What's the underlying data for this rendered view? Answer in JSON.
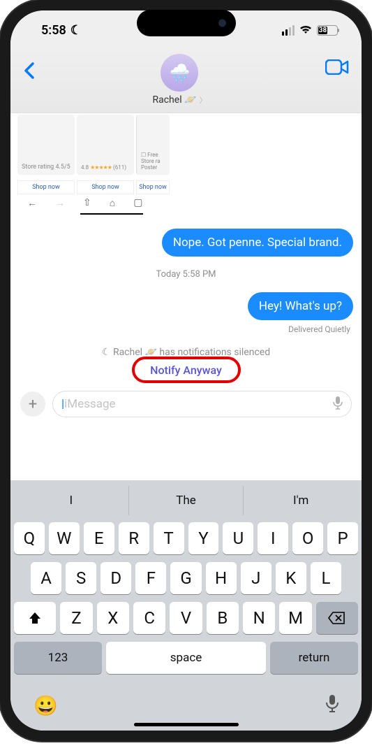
{
  "status": {
    "time": "5:58",
    "focus_icon": "☾",
    "battery_pct": "38"
  },
  "header": {
    "contact_name": "Rachel 🪐",
    "avatar_emoji": "🌧️"
  },
  "preview": {
    "card1_rating": "Store rating 4.5/5",
    "card2_score": "4.8",
    "card2_reviews": "(611)",
    "card3_line1": "Free",
    "card3_line2": "Store ra",
    "card3_line3": "Poster",
    "shop_label": "Shop now"
  },
  "messages": {
    "m1": "Nope. Got penne. Special brand.",
    "timestamp": "Today 5:58 PM",
    "m2": "Hey! What's up?",
    "delivered": "Delivered Quietly",
    "silenced_text": "Rachel 🪐 has notifications silenced",
    "notify_anyway": "Notify Anyway"
  },
  "input": {
    "placeholder": "iMessage"
  },
  "keyboard": {
    "predictions": [
      "I",
      "The",
      "I'm"
    ],
    "row1": [
      "Q",
      "W",
      "E",
      "R",
      "T",
      "Y",
      "U",
      "I",
      "O",
      "P"
    ],
    "row2": [
      "A",
      "S",
      "D",
      "F",
      "G",
      "H",
      "J",
      "K",
      "L"
    ],
    "row3": [
      "Z",
      "X",
      "C",
      "V",
      "B",
      "N",
      "M"
    ],
    "num_key": "123",
    "space_key": "space",
    "return_key": "return"
  }
}
